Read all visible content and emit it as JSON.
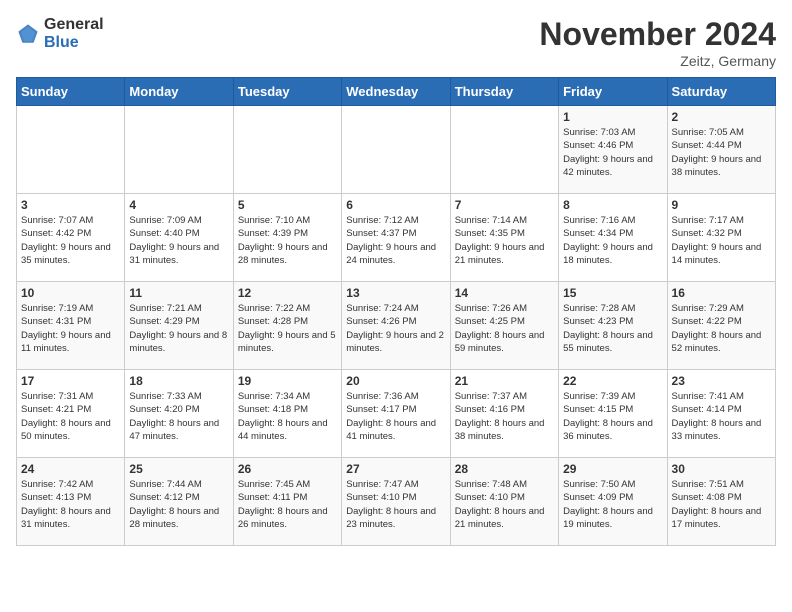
{
  "logo": {
    "general": "General",
    "blue": "Blue"
  },
  "title": "November 2024",
  "location": "Zeitz, Germany",
  "days_header": [
    "Sunday",
    "Monday",
    "Tuesday",
    "Wednesday",
    "Thursday",
    "Friday",
    "Saturday"
  ],
  "weeks": [
    [
      {
        "day": "",
        "info": ""
      },
      {
        "day": "",
        "info": ""
      },
      {
        "day": "",
        "info": ""
      },
      {
        "day": "",
        "info": ""
      },
      {
        "day": "",
        "info": ""
      },
      {
        "day": "1",
        "info": "Sunrise: 7:03 AM\nSunset: 4:46 PM\nDaylight: 9 hours and 42 minutes."
      },
      {
        "day": "2",
        "info": "Sunrise: 7:05 AM\nSunset: 4:44 PM\nDaylight: 9 hours and 38 minutes."
      }
    ],
    [
      {
        "day": "3",
        "info": "Sunrise: 7:07 AM\nSunset: 4:42 PM\nDaylight: 9 hours and 35 minutes."
      },
      {
        "day": "4",
        "info": "Sunrise: 7:09 AM\nSunset: 4:40 PM\nDaylight: 9 hours and 31 minutes."
      },
      {
        "day": "5",
        "info": "Sunrise: 7:10 AM\nSunset: 4:39 PM\nDaylight: 9 hours and 28 minutes."
      },
      {
        "day": "6",
        "info": "Sunrise: 7:12 AM\nSunset: 4:37 PM\nDaylight: 9 hours and 24 minutes."
      },
      {
        "day": "7",
        "info": "Sunrise: 7:14 AM\nSunset: 4:35 PM\nDaylight: 9 hours and 21 minutes."
      },
      {
        "day": "8",
        "info": "Sunrise: 7:16 AM\nSunset: 4:34 PM\nDaylight: 9 hours and 18 minutes."
      },
      {
        "day": "9",
        "info": "Sunrise: 7:17 AM\nSunset: 4:32 PM\nDaylight: 9 hours and 14 minutes."
      }
    ],
    [
      {
        "day": "10",
        "info": "Sunrise: 7:19 AM\nSunset: 4:31 PM\nDaylight: 9 hours and 11 minutes."
      },
      {
        "day": "11",
        "info": "Sunrise: 7:21 AM\nSunset: 4:29 PM\nDaylight: 9 hours and 8 minutes."
      },
      {
        "day": "12",
        "info": "Sunrise: 7:22 AM\nSunset: 4:28 PM\nDaylight: 9 hours and 5 minutes."
      },
      {
        "day": "13",
        "info": "Sunrise: 7:24 AM\nSunset: 4:26 PM\nDaylight: 9 hours and 2 minutes."
      },
      {
        "day": "14",
        "info": "Sunrise: 7:26 AM\nSunset: 4:25 PM\nDaylight: 8 hours and 59 minutes."
      },
      {
        "day": "15",
        "info": "Sunrise: 7:28 AM\nSunset: 4:23 PM\nDaylight: 8 hours and 55 minutes."
      },
      {
        "day": "16",
        "info": "Sunrise: 7:29 AM\nSunset: 4:22 PM\nDaylight: 8 hours and 52 minutes."
      }
    ],
    [
      {
        "day": "17",
        "info": "Sunrise: 7:31 AM\nSunset: 4:21 PM\nDaylight: 8 hours and 50 minutes."
      },
      {
        "day": "18",
        "info": "Sunrise: 7:33 AM\nSunset: 4:20 PM\nDaylight: 8 hours and 47 minutes."
      },
      {
        "day": "19",
        "info": "Sunrise: 7:34 AM\nSunset: 4:18 PM\nDaylight: 8 hours and 44 minutes."
      },
      {
        "day": "20",
        "info": "Sunrise: 7:36 AM\nSunset: 4:17 PM\nDaylight: 8 hours and 41 minutes."
      },
      {
        "day": "21",
        "info": "Sunrise: 7:37 AM\nSunset: 4:16 PM\nDaylight: 8 hours and 38 minutes."
      },
      {
        "day": "22",
        "info": "Sunrise: 7:39 AM\nSunset: 4:15 PM\nDaylight: 8 hours and 36 minutes."
      },
      {
        "day": "23",
        "info": "Sunrise: 7:41 AM\nSunset: 4:14 PM\nDaylight: 8 hours and 33 minutes."
      }
    ],
    [
      {
        "day": "24",
        "info": "Sunrise: 7:42 AM\nSunset: 4:13 PM\nDaylight: 8 hours and 31 minutes."
      },
      {
        "day": "25",
        "info": "Sunrise: 7:44 AM\nSunset: 4:12 PM\nDaylight: 8 hours and 28 minutes."
      },
      {
        "day": "26",
        "info": "Sunrise: 7:45 AM\nSunset: 4:11 PM\nDaylight: 8 hours and 26 minutes."
      },
      {
        "day": "27",
        "info": "Sunrise: 7:47 AM\nSunset: 4:10 PM\nDaylight: 8 hours and 23 minutes."
      },
      {
        "day": "28",
        "info": "Sunrise: 7:48 AM\nSunset: 4:10 PM\nDaylight: 8 hours and 21 minutes."
      },
      {
        "day": "29",
        "info": "Sunrise: 7:50 AM\nSunset: 4:09 PM\nDaylight: 8 hours and 19 minutes."
      },
      {
        "day": "30",
        "info": "Sunrise: 7:51 AM\nSunset: 4:08 PM\nDaylight: 8 hours and 17 minutes."
      }
    ]
  ]
}
